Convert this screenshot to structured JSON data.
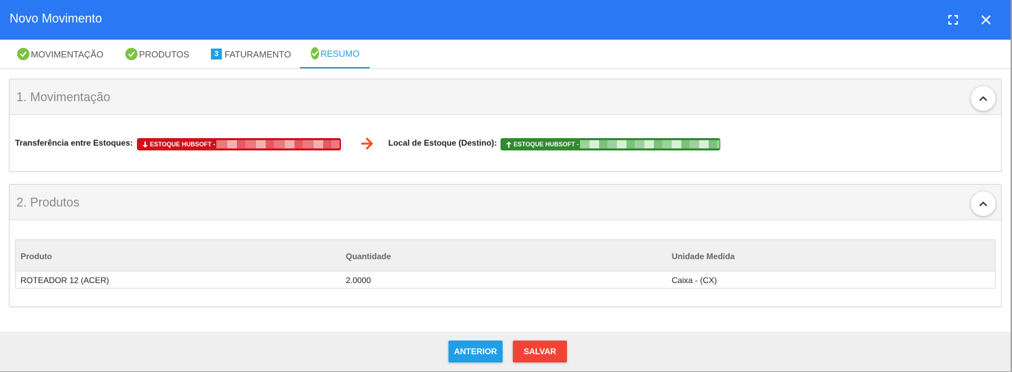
{
  "dialog": {
    "title": "Novo Movimento",
    "icons": {
      "expand": "fullscreen-icon",
      "close": "close-icon"
    }
  },
  "tabs": [
    {
      "label": "MOVIMENTAÇÃO",
      "status": "check"
    },
    {
      "label": "PRODUTOS",
      "status": "check"
    },
    {
      "label": "FATURAMENTO",
      "number": "3"
    },
    {
      "label": "RESUMO",
      "status": "check",
      "active": true
    }
  ],
  "sections": {
    "movimentacao": {
      "title": "1. Movimentação",
      "from_label": "Transferência entre Estoques:",
      "from_badge": "ESTOQUE HUBSOFT -",
      "to_label": "Local de Estoque (Destino):",
      "to_badge": "ESTOQUE HUBSOFT -"
    },
    "produtos": {
      "title": "2. Produtos",
      "columns": [
        "Produto",
        "Quantidade",
        "Unidade Medida"
      ],
      "rows": [
        [
          "ROTEADOR 12 (ACER)",
          "2.0000",
          "Caixa - (CX)"
        ]
      ]
    }
  },
  "footer": {
    "prev_label": "ANTERIOR",
    "save_label": "SALVAR"
  },
  "colors": {
    "header": "#2b78f5",
    "accent": "#1e9fe8",
    "check": "#7cc242",
    "from_badge": "#d0101a",
    "to_badge": "#2e8b2e",
    "arrow": "#f4511e",
    "save": "#f44336"
  }
}
